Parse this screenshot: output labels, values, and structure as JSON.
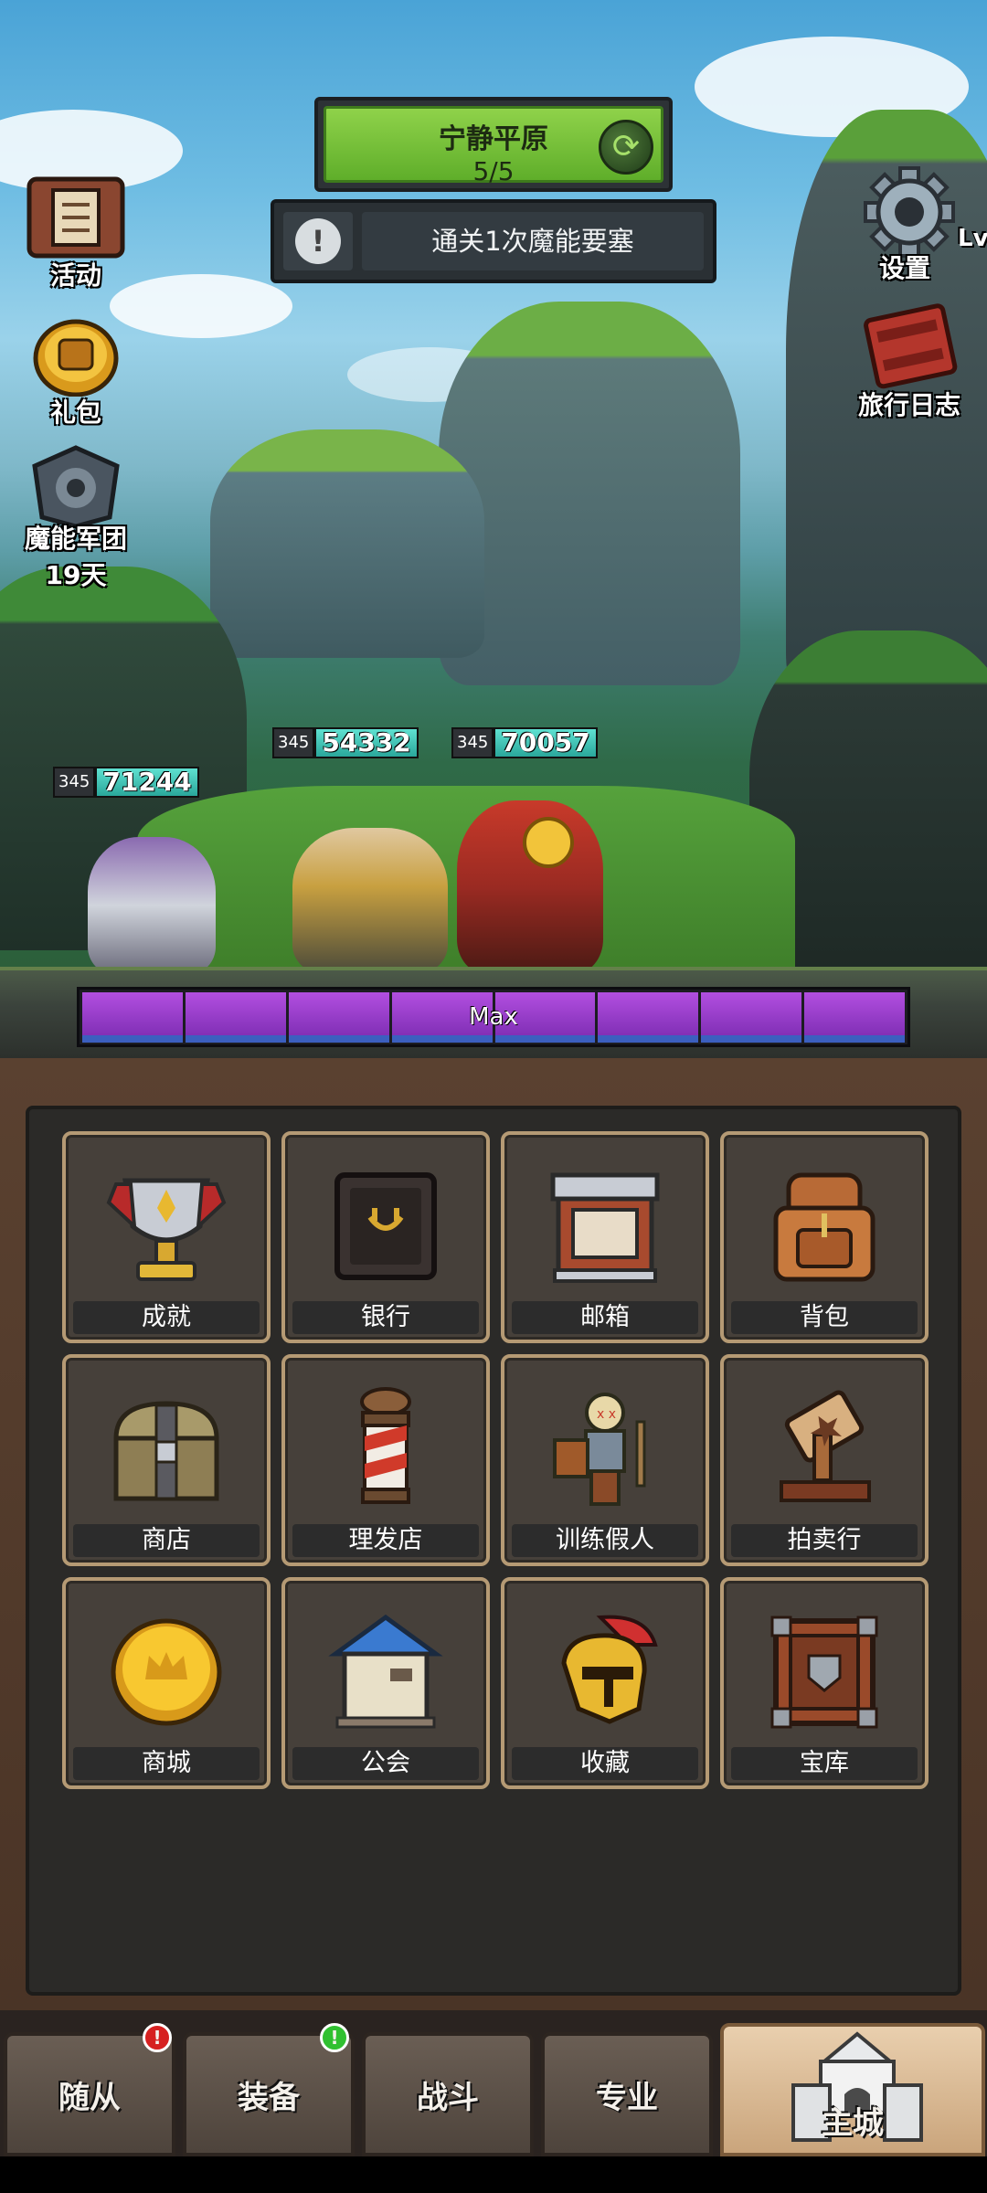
{
  "stage": {
    "name": "宁静平原",
    "progress": "5/5"
  },
  "quest": {
    "text": "通关1次魔能要塞"
  },
  "left_icons": [
    {
      "label": "活动"
    },
    {
      "label": "礼包"
    },
    {
      "label": "魔能军团",
      "sub": "19天"
    }
  ],
  "right_icons": [
    {
      "label": "设置",
      "extra": "Lv"
    },
    {
      "label": "旅行日志"
    }
  ],
  "heroes": [
    {
      "level": "345",
      "hp": "71244"
    },
    {
      "level": "345",
      "hp": "54332"
    },
    {
      "level": "345",
      "hp": "70057"
    }
  ],
  "energy_bar": {
    "label": "Max",
    "segments": 8
  },
  "buildings": [
    {
      "label": "成就",
      "icon": "trophy-icon"
    },
    {
      "label": "银行",
      "icon": "safe-icon"
    },
    {
      "label": "邮箱",
      "icon": "mailbox-icon"
    },
    {
      "label": "背包",
      "icon": "backpack-icon"
    },
    {
      "label": "商店",
      "icon": "chest-icon"
    },
    {
      "label": "理发店",
      "icon": "barber-pole-icon"
    },
    {
      "label": "训练假人",
      "icon": "training-dummy-icon"
    },
    {
      "label": "拍卖行",
      "icon": "gavel-icon"
    },
    {
      "label": "商城",
      "icon": "gold-coin-icon"
    },
    {
      "label": "公会",
      "icon": "guild-house-icon"
    },
    {
      "label": "收藏",
      "icon": "helmet-icon"
    },
    {
      "label": "宝库",
      "icon": "vault-icon"
    }
  ],
  "nav": [
    {
      "label": "随从",
      "badge": "!",
      "badge_color": "red"
    },
    {
      "label": "装备",
      "badge": "!",
      "badge_color": "green"
    },
    {
      "label": "战斗"
    },
    {
      "label": "专业"
    },
    {
      "label": "主城",
      "active": true
    }
  ],
  "colors": {
    "stage_green": "#7cc43c",
    "hp_teal": "#3cc4b4",
    "energy_purple": "#9a3fd0",
    "panel_border": "#b59a74"
  }
}
